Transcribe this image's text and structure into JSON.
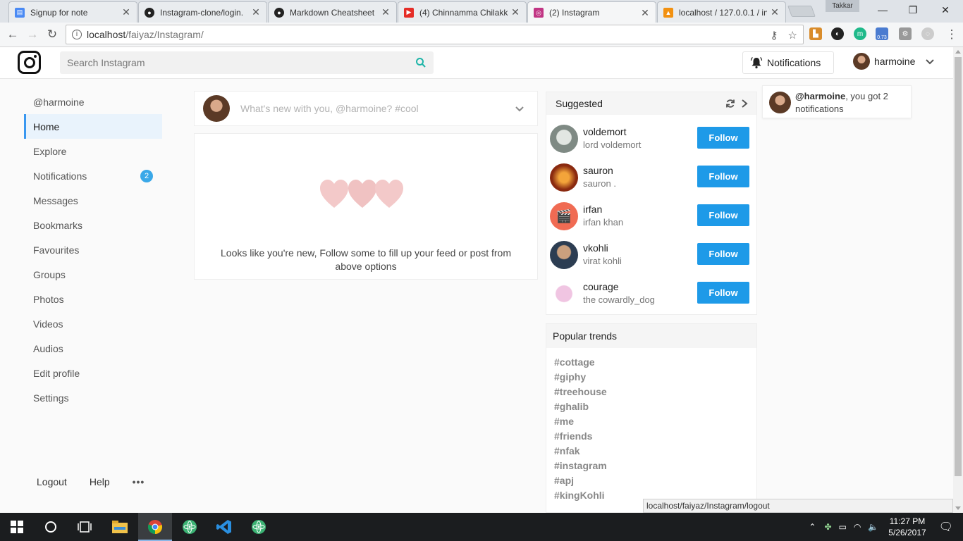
{
  "browser": {
    "tabs": [
      {
        "title": "Signup for note",
        "icon_color": "#4a8af4"
      },
      {
        "title": "Instagram-clone/login.",
        "icon_color": "#222222"
      },
      {
        "title": "Markdown Cheatsheet",
        "icon_color": "#222222"
      },
      {
        "title": "(4) Chinnamma Chilakk",
        "icon_color": "#e52d27"
      },
      {
        "title": "(2) Instagram",
        "icon_color": "#c13584"
      },
      {
        "title": "localhost / 127.0.0.1 / in",
        "icon_color": "#f29111"
      }
    ],
    "profile_name": "Takkar",
    "url_host": "localhost",
    "url_path": "/faiyaz/Instagram/",
    "extension_badge": "0.73"
  },
  "header": {
    "search_placeholder": "Search Instagram",
    "notifications_label": "Notifications",
    "username": "harmoine"
  },
  "sidebar": {
    "handle": "@harmoine",
    "items": [
      {
        "label": "Home"
      },
      {
        "label": "Explore"
      },
      {
        "label": "Notifications",
        "badge": "2"
      },
      {
        "label": "Messages"
      },
      {
        "label": "Bookmarks"
      },
      {
        "label": "Favourites"
      },
      {
        "label": "Groups"
      },
      {
        "label": "Photos"
      },
      {
        "label": "Videos"
      },
      {
        "label": "Audios"
      },
      {
        "label": "Edit profile"
      },
      {
        "label": "Settings"
      }
    ],
    "footer": {
      "logout": "Logout",
      "help": "Help",
      "more": "•••"
    }
  },
  "composer": {
    "placeholder": "What's new with you, @harmoine? #cool"
  },
  "feed": {
    "empty_message": "Looks like you're new, Follow some to fill up your feed or post from above options"
  },
  "suggested": {
    "title": "Suggested",
    "follow_label": "Follow",
    "users": [
      {
        "username": "voldemort",
        "fullname": "lord voldemort",
        "avatar_color": "#9aa19a"
      },
      {
        "username": "sauron",
        "fullname": "sauron .",
        "avatar_color": "#b8431b"
      },
      {
        "username": "irfan",
        "fullname": "irfan khan",
        "avatar_color": "#f06b53"
      },
      {
        "username": "vkohli",
        "fullname": "virat kohli",
        "avatar_color": "#3c5a78"
      },
      {
        "username": "courage",
        "fullname": "the cowardly_dog",
        "avatar_color": "#e7b8d8"
      }
    ]
  },
  "trends": {
    "title": "Popular trends",
    "items": [
      "#cottage",
      "#giphy",
      "#treehouse",
      "#ghalib",
      "#me",
      "#friends",
      "#nfak",
      "#instagram",
      "#apj",
      "#kingKohli"
    ]
  },
  "popover": {
    "user": "@harmoine",
    "message": ", you got 2 notifications"
  },
  "status_link": "localhost/faiyaz/Instagram/logout",
  "taskbar": {
    "time": "11:27 PM",
    "date": "5/26/2017"
  },
  "colors": {
    "accent": "#1e9ae8",
    "badge": "#3aa8e8",
    "heart": "#f3c9c9"
  }
}
